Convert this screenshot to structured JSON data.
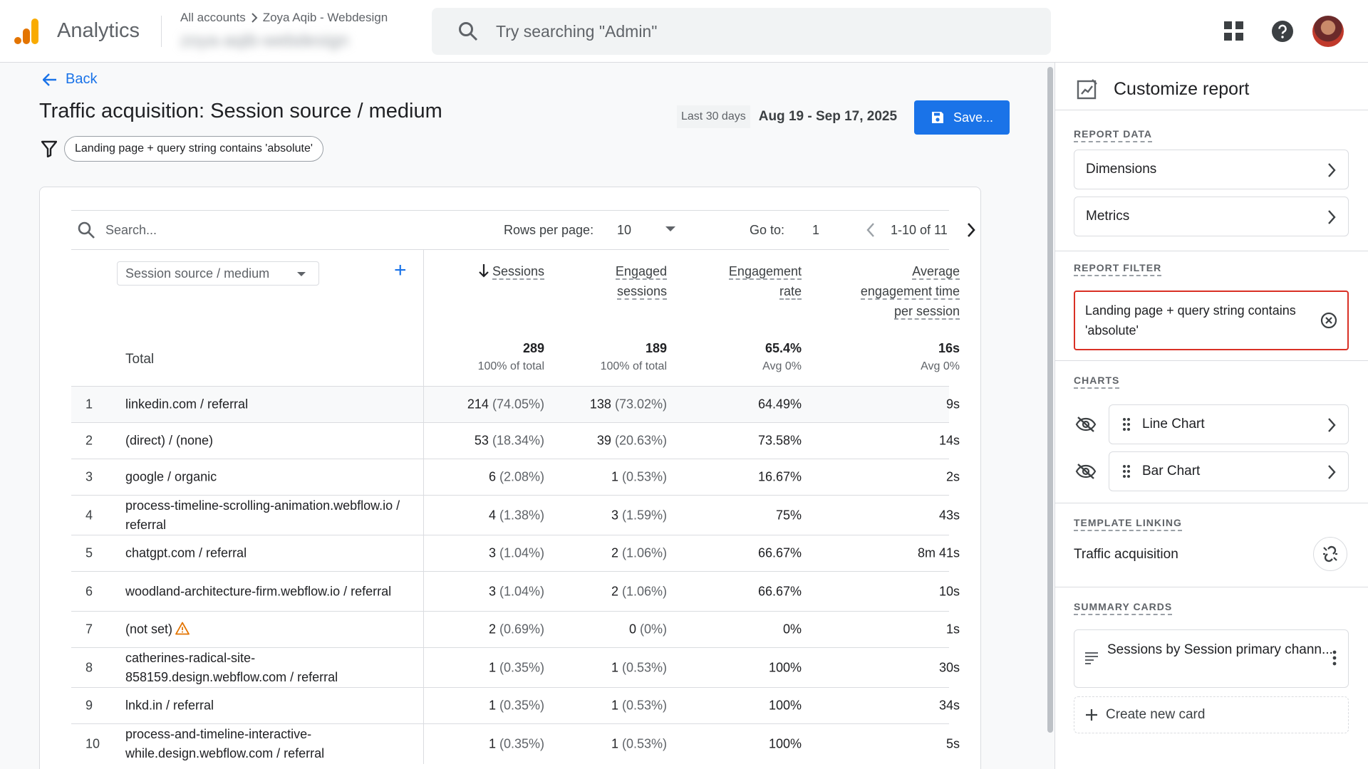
{
  "app": {
    "name": "Analytics"
  },
  "account": {
    "breadcrumb_root": "All accounts",
    "breadcrumb_account": "Zoya Aqib - Webdesign",
    "property_blurred": "zoya-aqib-webdesign"
  },
  "search": {
    "placeholder": "Try searching \"Admin\""
  },
  "page": {
    "back_label": "Back",
    "title": "Traffic acquisition: Session source / medium",
    "filter_chip": "Landing page + query string contains 'absolute'",
    "date_label": "Last 30 days",
    "date_range": "Aug 19 - Sep 17, 2025",
    "save_label": "Save..."
  },
  "toolbar": {
    "search_placeholder": "Search...",
    "rows_label": "Rows per page:",
    "rows_value": "10",
    "goto_label": "Go to:",
    "goto_value": "1",
    "pagination": "1-10 of 11"
  },
  "table": {
    "dimension": "Session source / medium",
    "add_symbol": "+",
    "headers": {
      "sessions": "Sessions",
      "engaged_1": "Engaged",
      "engaged_2": "sessions",
      "rate_1": "Engagement",
      "rate_2": "rate",
      "time_1": "Average",
      "time_2": "engagement time",
      "time_3": "per session"
    },
    "total": {
      "label": "Total",
      "sessions": "289",
      "sessions_sub": "100% of total",
      "engaged": "189",
      "engaged_sub": "100% of total",
      "rate": "65.4%",
      "rate_sub": "Avg 0%",
      "time": "16s",
      "time_sub": "Avg 0%"
    },
    "rows": [
      {
        "idx": "1",
        "name": "linkedin.com / referral",
        "s": "214",
        "sp": "(74.05%)",
        "e": "138",
        "ep": "(73.02%)",
        "r": "64.49%",
        "t": "9s"
      },
      {
        "idx": "2",
        "name": "(direct) / (none)",
        "s": "53",
        "sp": "(18.34%)",
        "e": "39",
        "ep": "(20.63%)",
        "r": "73.58%",
        "t": "14s"
      },
      {
        "idx": "3",
        "name": "google / organic",
        "s": "6",
        "sp": "(2.08%)",
        "e": "1",
        "ep": "(0.53%)",
        "r": "16.67%",
        "t": "2s"
      },
      {
        "idx": "4",
        "name": "process-timeline-scrolling-animation.webflow.io / referral",
        "s": "4",
        "sp": "(1.38%)",
        "e": "3",
        "ep": "(1.59%)",
        "r": "75%",
        "t": "43s"
      },
      {
        "idx": "5",
        "name": "chatgpt.com / referral",
        "s": "3",
        "sp": "(1.04%)",
        "e": "2",
        "ep": "(1.06%)",
        "r": "66.67%",
        "t": "8m 41s"
      },
      {
        "idx": "6",
        "name": "woodland-architecture-firm.webflow.io / referral",
        "s": "3",
        "sp": "(1.04%)",
        "e": "2",
        "ep": "(1.06%)",
        "r": "66.67%",
        "t": "10s"
      },
      {
        "idx": "7",
        "name": "(not set)",
        "s": "2",
        "sp": "(0.69%)",
        "e": "0",
        "ep": "(0%)",
        "r": "0%",
        "t": "1s"
      },
      {
        "idx": "8",
        "name": "catherines-radical-site-858159.design.webflow.com / referral",
        "s": "1",
        "sp": "(0.35%)",
        "e": "1",
        "ep": "(0.53%)",
        "r": "100%",
        "t": "30s"
      },
      {
        "idx": "9",
        "name": "lnkd.in / referral",
        "s": "1",
        "sp": "(0.35%)",
        "e": "1",
        "ep": "(0.53%)",
        "r": "100%",
        "t": "34s"
      },
      {
        "idx": "10",
        "name": "process-and-timeline-interactive-while.design.webflow.com / referral",
        "s": "1",
        "sp": "(0.35%)",
        "e": "1",
        "ep": "(0.53%)",
        "r": "100%",
        "t": "5s"
      }
    ]
  },
  "panel": {
    "title": "Customize report",
    "report_data_label": "REPORT DATA",
    "dimensions": "Dimensions",
    "metrics": "Metrics",
    "report_filter_label": "REPORT FILTER",
    "filter_text": "Landing page + query string contains 'absolute'",
    "charts_label": "CHARTS",
    "line_chart": "Line Chart",
    "bar_chart": "Bar Chart",
    "template_label": "TEMPLATE LINKING",
    "template_name": "Traffic acquisition",
    "summary_label": "SUMMARY CARDS",
    "summary_card": "Sessions by Session primary chann...",
    "create_card": "Create new card"
  },
  "colors": {
    "accent": "#1a73e8",
    "filter_border": "#d93025",
    "logo_orange": "#f9ab00",
    "logo_dark": "#e37400",
    "warning": "#e37400"
  }
}
